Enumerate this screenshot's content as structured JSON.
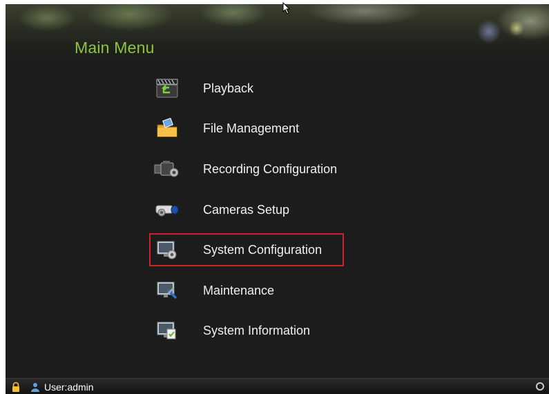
{
  "header": {
    "title": "Main Menu"
  },
  "menu": {
    "items": [
      {
        "label": "Playback",
        "icon": "playback-icon"
      },
      {
        "label": "File Management",
        "icon": "folder-icon"
      },
      {
        "label": "Recording Configuration",
        "icon": "camcorder-gear-icon"
      },
      {
        "label": "Cameras Setup",
        "icon": "camera-gear-icon"
      },
      {
        "label": "System Configuration",
        "icon": "monitor-gear-icon",
        "selected": true
      },
      {
        "label": "Maintenance",
        "icon": "monitor-wrench-icon"
      },
      {
        "label": "System Information",
        "icon": "monitor-info-icon"
      }
    ]
  },
  "statusbar": {
    "user": "User:admin"
  },
  "colors": {
    "title": "#8cc63f",
    "highlight": "#d0202a",
    "background": "#1c1c1c"
  }
}
